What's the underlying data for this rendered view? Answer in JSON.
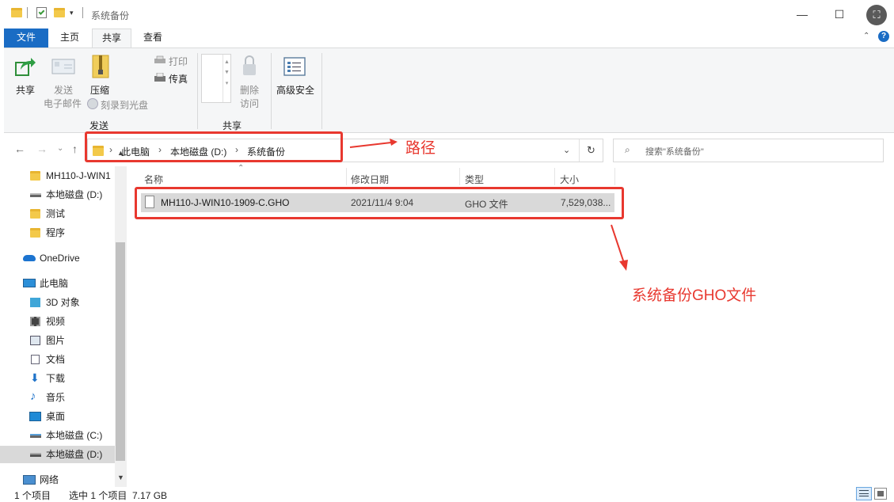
{
  "window": {
    "title": "系统备份"
  },
  "tabs": {
    "file": "文件",
    "home": "主页",
    "share": "共享",
    "view": "查看"
  },
  "ribbon": {
    "share": "共享",
    "send_email_1": "发送",
    "send_email_2": "电子邮件",
    "zip": "压缩",
    "print": "打印",
    "fax": "传真",
    "burn": "刻录到光盘",
    "group_send": "发送",
    "remove_access_1": "删除",
    "remove_access_2": "访问",
    "group_share": "共享",
    "advanced_security": "高级安全"
  },
  "address": {
    "crumbs": [
      "此电脑",
      "本地磁盘 (D:)",
      "系统备份"
    ],
    "search_placeholder": "搜索\"系统备份\""
  },
  "sidebar": {
    "items": [
      {
        "label": "MH110-J-WIN1"
      },
      {
        "label": "本地磁盘 (D:)"
      },
      {
        "label": "测试"
      },
      {
        "label": "程序"
      },
      {
        "label": "OneDrive"
      },
      {
        "label": "此电脑"
      },
      {
        "label": "3D 对象"
      },
      {
        "label": "视频"
      },
      {
        "label": "图片"
      },
      {
        "label": "文档"
      },
      {
        "label": "下载"
      },
      {
        "label": "音乐"
      },
      {
        "label": "桌面"
      },
      {
        "label": "本地磁盘 (C:)"
      },
      {
        "label": "本地磁盘 (D:)"
      },
      {
        "label": "网络"
      }
    ]
  },
  "columns": {
    "name": "名称",
    "date": "修改日期",
    "type": "类型",
    "size": "大小"
  },
  "files": [
    {
      "name": "MH110-J-WIN10-1909-C.GHO",
      "date": "2021/11/4 9:04",
      "type": "GHO 文件",
      "size": "7,529,038..."
    }
  ],
  "annotations": {
    "path": "路径",
    "gho": "系统备份GHO文件"
  },
  "status": {
    "count": "1 个项目",
    "selected": "选中 1 个项目  7.17 GB"
  },
  "colors": {
    "accent": "#1a6cc4",
    "annotation": "#e8382f",
    "selection": "#d9d9d9"
  }
}
